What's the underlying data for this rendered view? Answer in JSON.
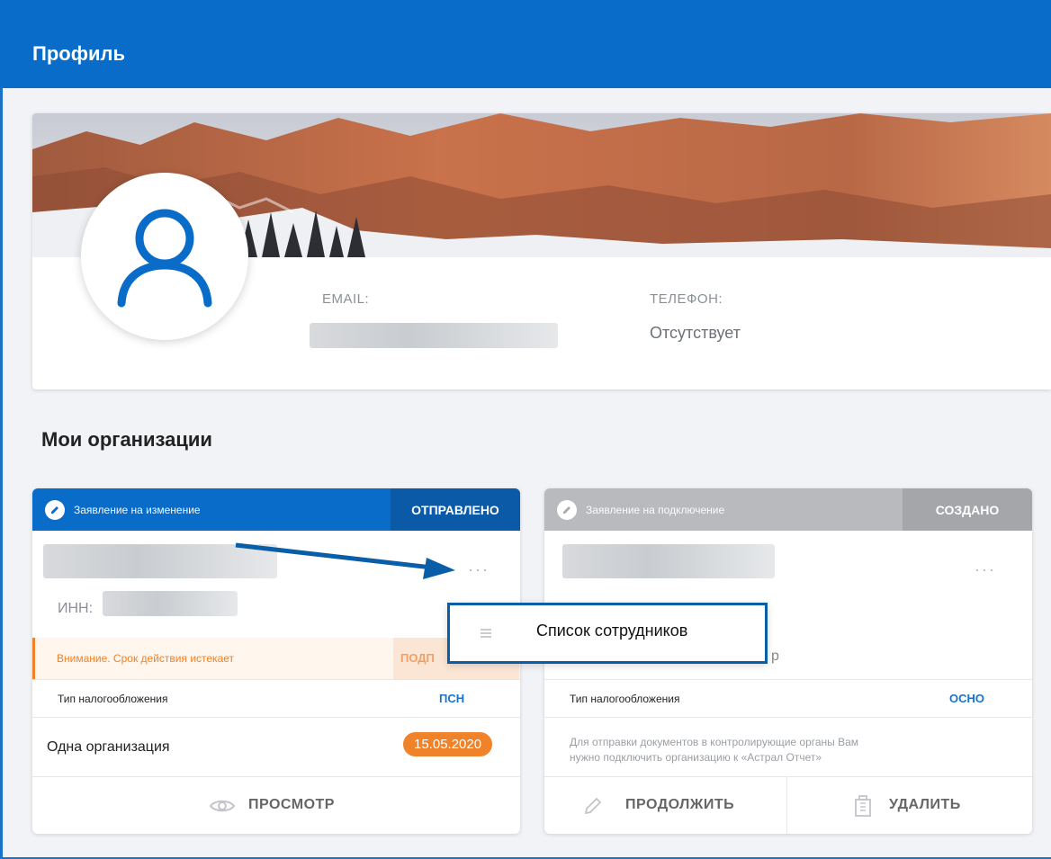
{
  "header": {
    "title": "Профиль"
  },
  "profile": {
    "email_label": "EMAIL:",
    "phone_label": "ТЕЛЕФОН:",
    "phone_value": "Отсутствует"
  },
  "section": {
    "title": "Мои организации"
  },
  "org1": {
    "head_title": "Заявление на изменение",
    "status": "ОТПРАВЛЕНО",
    "inn_label": "ИНН:",
    "warning": "Внимание. Срок действия истекает",
    "warning_action": "ПОДП",
    "tax_label": "Тип налогообложения",
    "tax_value": "ПСН",
    "one_org_label": "Одна организация",
    "date": "15.05.2020",
    "view_label": "ПРОСМОТР"
  },
  "org2": {
    "head_title": "Заявление на подключение",
    "status": "СОЗДАНО",
    "partial_text": "р",
    "tax_label": "Тип налогообложения",
    "tax_value": "ОСНО",
    "info_line1": "Для отправки документов в контролирующие органы Вам",
    "info_line2": "нужно подключить организацию к «Астрал Отчет»",
    "continue_label": "ПРОДОЛЖИТЬ",
    "delete_label": "УДАЛИТЬ"
  },
  "popup": {
    "item_label": "Список сотрудников"
  },
  "colors": {
    "primary": "#0a6cc9",
    "accent_orange": "#f0822a",
    "muted_gray": "#a9abae",
    "popup_border": "#0a5ea8"
  },
  "icons": [
    "user-icon",
    "edit-icon",
    "more-dots-icon",
    "eye-icon",
    "pencil-icon",
    "trash-icon",
    "list-icon",
    "arrow-annotation"
  ]
}
